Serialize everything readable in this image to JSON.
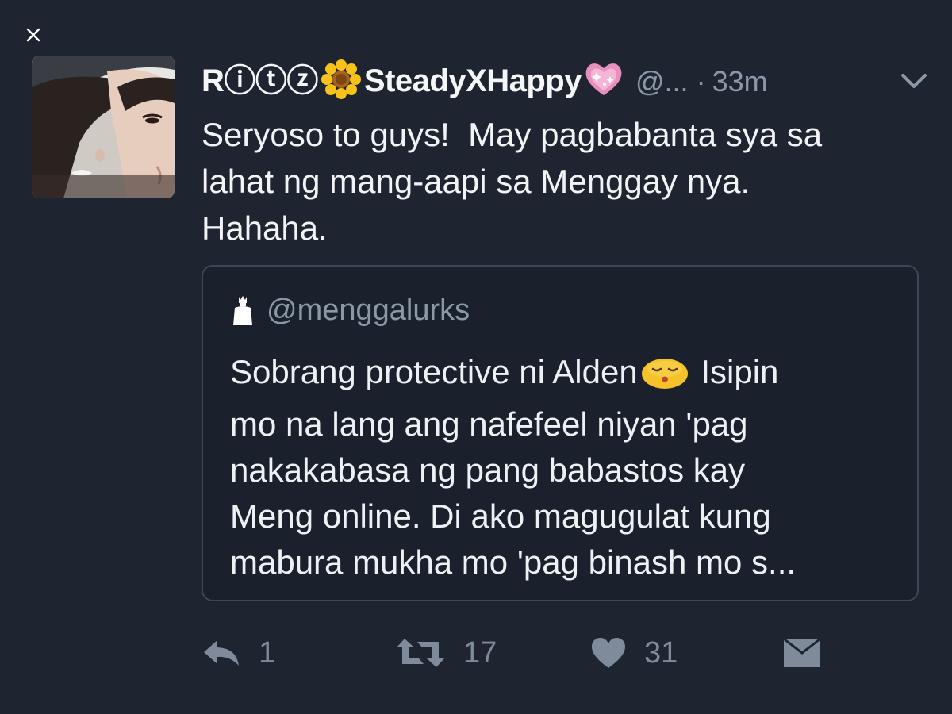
{
  "window": {
    "close_icon": "close-icon"
  },
  "tweet": {
    "display_name_prefix": "R",
    "display_name_circled": [
      "ⓘ",
      "ⓣ",
      "ⓩ"
    ],
    "display_name_main": "SteadyXHappy",
    "handle": "@...",
    "separator": "·",
    "timestamp": "33m",
    "text": "Seryoso to guys!  May pagbabanta sya sa\nlahat ng mang-aapi sa Menggay nya.\nHahaha.",
    "icons": {
      "avatar": "profile-avatar",
      "name_flower": "sunflower-emoji",
      "name_heart": "sparkling-heart-emoji",
      "menu": "chevron-down-icon"
    }
  },
  "quote": {
    "handle": "@menggalurks",
    "text_before_emoji": "Sobrang protective ni Alden",
    "text_after_emoji": " Isipin\nmo na lang ang nafefeel niyan 'pag\nnakakabasa ng pang babastos kay\nMeng online. Di ako magugulat kung\nmabura mukha mo 'pag binash mo s...",
    "icons": {
      "avatar": "crown-figure-icon",
      "inline_emoji": "kissing-face-emoji"
    }
  },
  "actions": {
    "reply_count": "1",
    "retweet_count": "17",
    "like_count": "31",
    "icons": {
      "reply": "reply-icon",
      "retweet": "retweet-icon",
      "like": "heart-icon",
      "dm": "envelope-icon"
    }
  },
  "colors": {
    "background": "#1e2531",
    "card_border": "#3c4656",
    "muted_text": "#8b98a8",
    "primary_text": "#f1f3f5"
  }
}
